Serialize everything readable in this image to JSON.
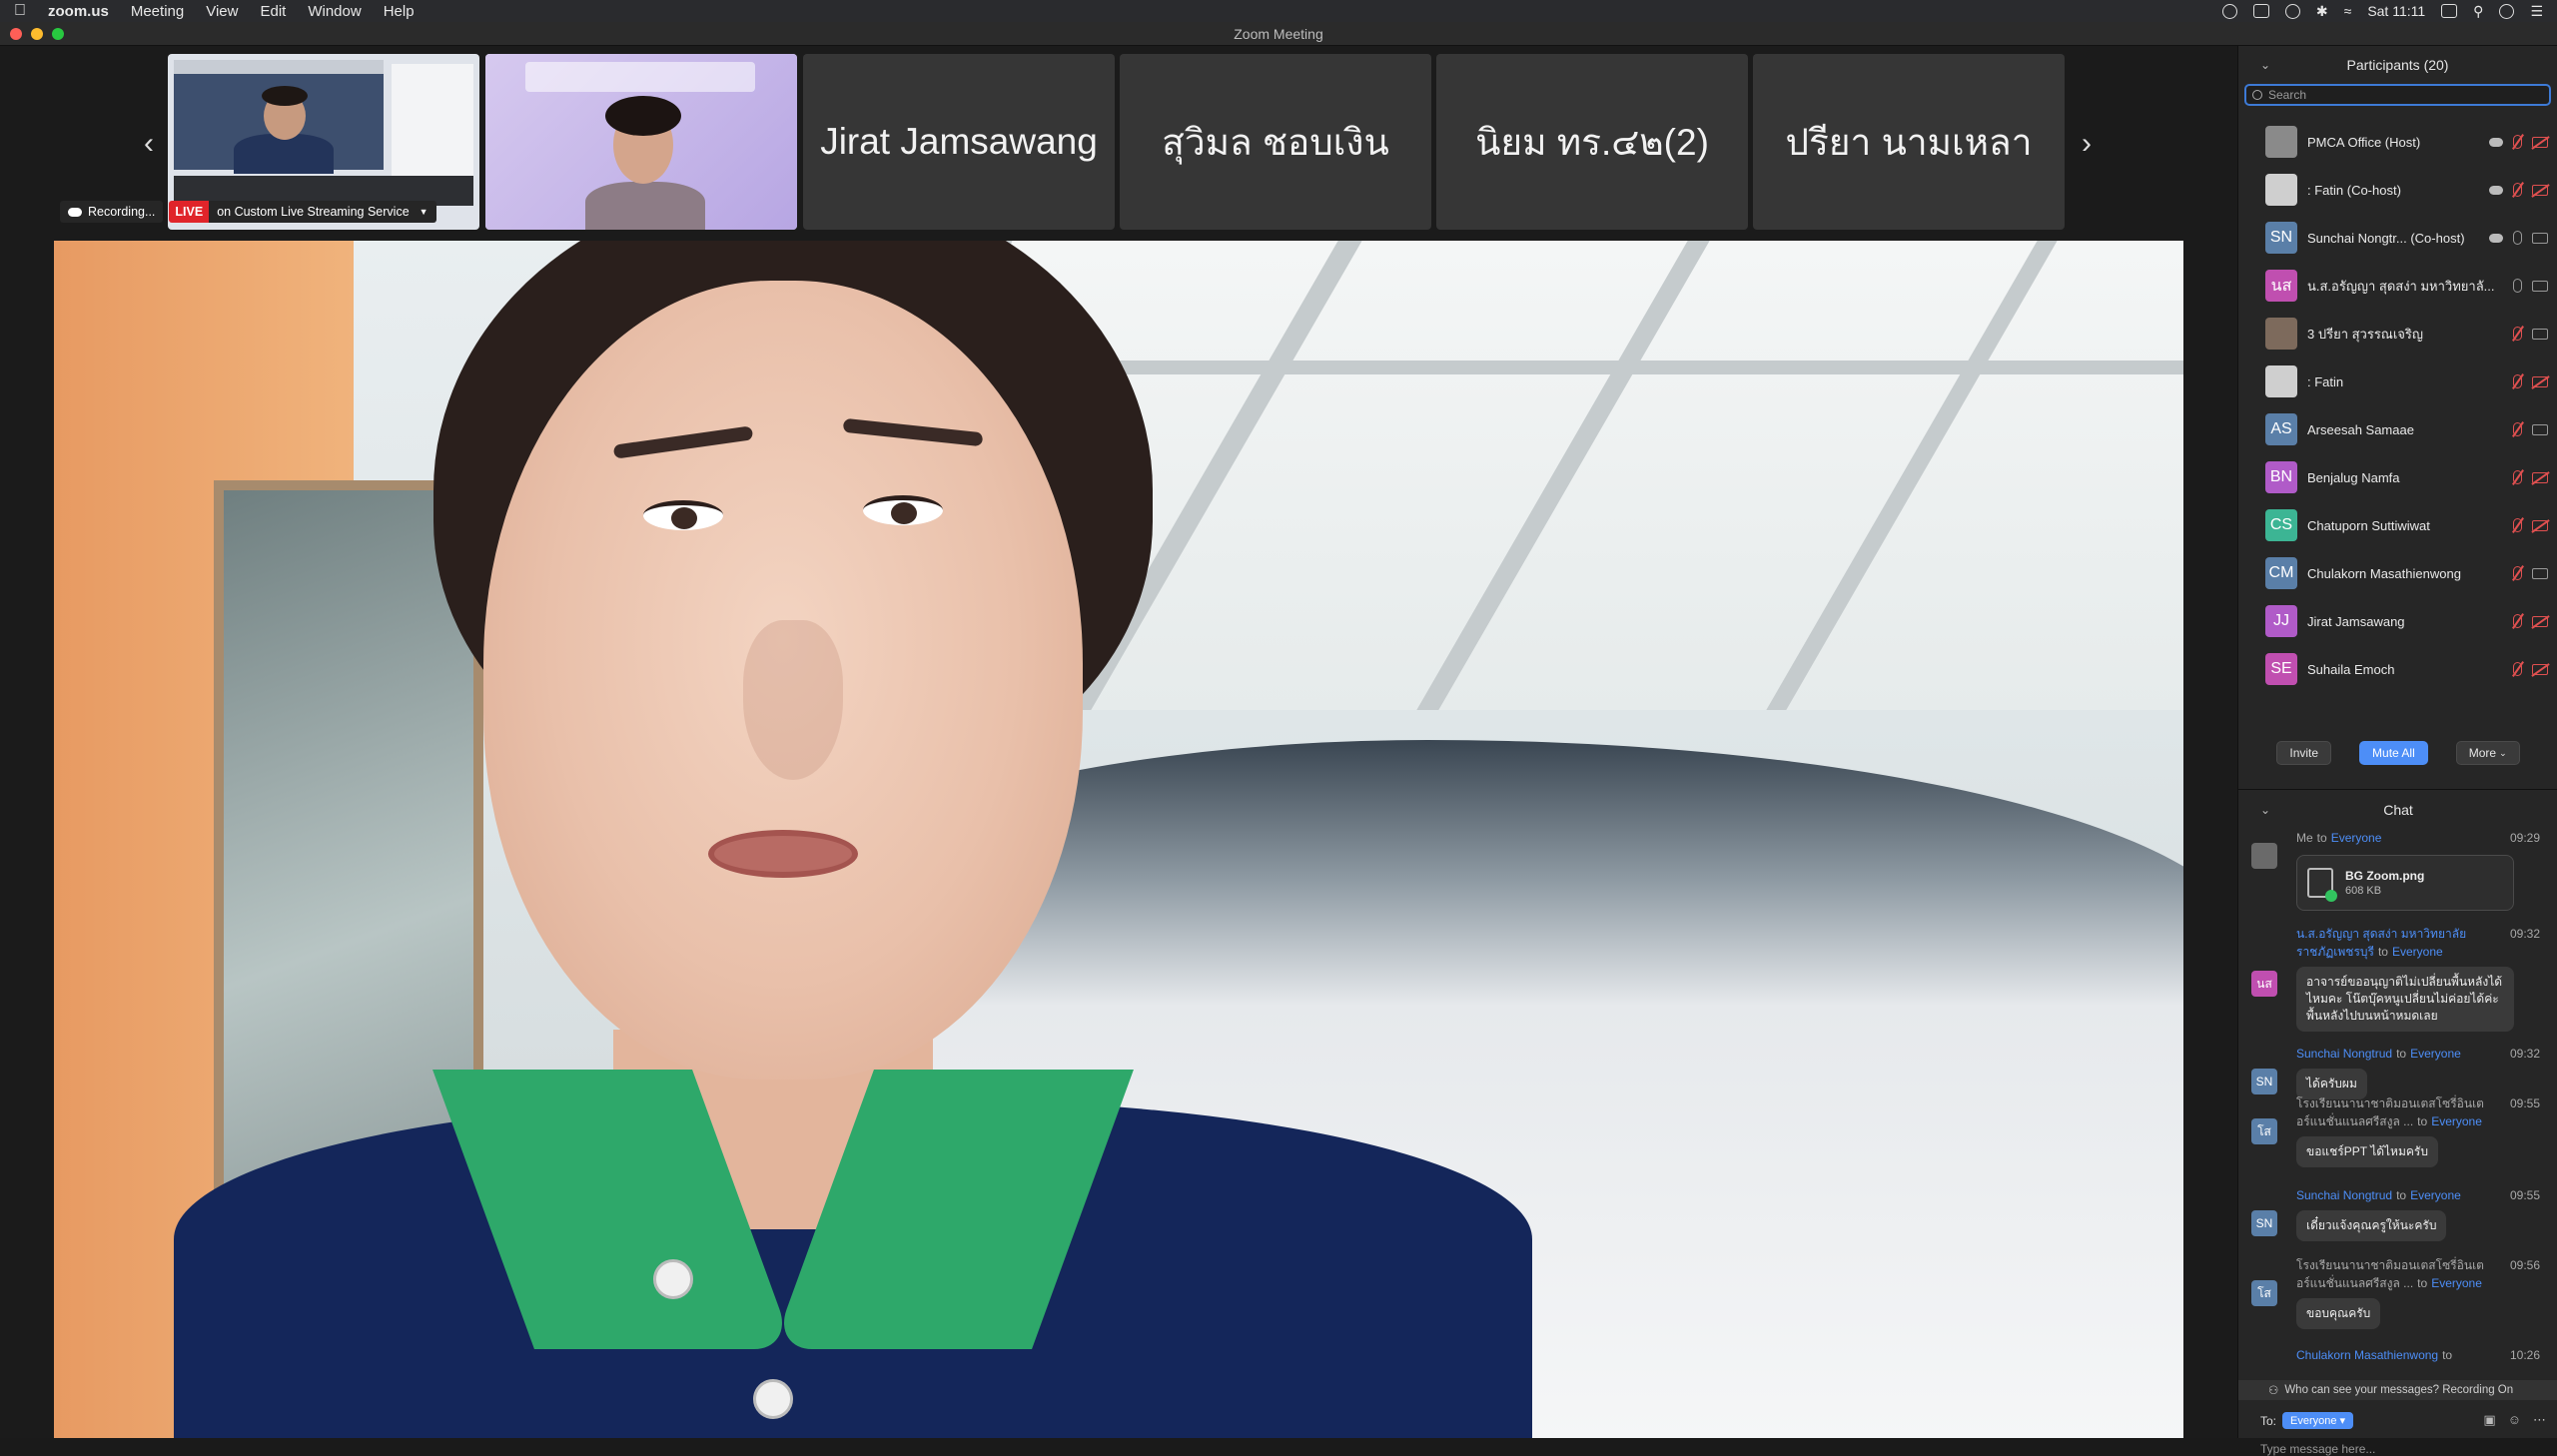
{
  "menubar": {
    "app": "zoom.us",
    "items": [
      "Meeting",
      "View",
      "Edit",
      "Window",
      "Help"
    ],
    "clock": "Sat 11:11"
  },
  "window": {
    "title": "Zoom Meeting"
  },
  "strip": {
    "tiles": [
      "Jirat Jamsawang",
      "สุวิมล  ชอบเงิน",
      "นิยม ทร.๔๒(2)",
      "ปรียา นามเหลา"
    ]
  },
  "recording": {
    "rec_label": "Recording...",
    "live_label": "LIVE",
    "stream_label": "on Custom Live Streaming Service"
  },
  "participants": {
    "title": "Participants (20)",
    "search_placeholder": "Search",
    "list": [
      {
        "name": "PMCA Office (Host)",
        "initials": "",
        "color": "#8a8a8a"
      },
      {
        "name": ": Fatin (Co-host)",
        "initials": "",
        "color": "#cfcfcf"
      },
      {
        "name": "Sunchai Nongtr... (Co-host)",
        "initials": "SN",
        "color": "#5a7fa8"
      },
      {
        "name": "น.ส.อรัญญา  สุดสง่า มหาวิทยาลั...",
        "initials": "นส",
        "color": "#c04fb0"
      },
      {
        "name": "3 ปรียา สุวรรณเจริญ",
        "initials": "",
        "color": "#7d6a5c"
      },
      {
        "name": ": Fatin",
        "initials": "",
        "color": "#cfcfcf"
      },
      {
        "name": "Arseesah Samaae",
        "initials": "AS",
        "color": "#5a7fa8"
      },
      {
        "name": "Benjalug Namfa",
        "initials": "BN",
        "color": "#b05bc8"
      },
      {
        "name": "Chatuporn Suttiwiwat",
        "initials": "CS",
        "color": "#3cb594"
      },
      {
        "name": "Chulakorn Masathienwong",
        "initials": "CM",
        "color": "#5a7fa8"
      },
      {
        "name": "Jirat Jamsawang",
        "initials": "JJ",
        "color": "#b05bc8"
      },
      {
        "name": "Suhaila Emoch",
        "initials": "SE",
        "color": "#c04fb0"
      }
    ],
    "invite_label": "Invite",
    "mute_all_label": "Mute All",
    "more_label": "More"
  },
  "chat": {
    "title": "Chat",
    "to_word": "to",
    "messages": [
      {
        "sender": "Me",
        "recipient": "Everyone",
        "time": "09:29",
        "initials": "",
        "color": "#6a6a6a",
        "file": {
          "name": "BG Zoom.png",
          "size": "608 KB"
        }
      },
      {
        "sender": "น.ส.อรัญญา  สุดสง่า มหาวิทยาลัยราชภัฏเพชรบุรี",
        "recipient": "Everyone",
        "time": "09:32",
        "initials": "นส",
        "color": "#c04fb0",
        "text": "อาจารย์ขออนุญาติไม่เปลี่ยนพื้นหลังได้ไหมคะ โน๊ตบุ๊คหนูเปลี่ยนไม่ค่อยได้ค่ะ พื้นหลังไปบนหน้าหมดเลย"
      },
      {
        "sender": "Sunchai Nongtrud",
        "recipient": "Everyone",
        "time": "09:32",
        "initials": "SN",
        "color": "#5a7fa8",
        "text": "ได้ครับผม"
      },
      {
        "sender": "โรงเรียนนานาชาติมอนเตสโซรี่อินเตอร์แนชั่นแนลศรีสงูล ...",
        "recipient": "Everyone",
        "time": "09:55",
        "initials": "โส",
        "color": "#5a7fa8",
        "text": "ขอแชร์PPT ได้ไหมครับ"
      },
      {
        "sender": "Sunchai Nongtrud",
        "recipient": "Everyone",
        "time": "09:55",
        "initials": "SN",
        "color": "#5a7fa8",
        "text": "เดี๋ยวแจ้งคุณครูให้นะครับ"
      },
      {
        "sender": "โรงเรียนนานาชาติมอนเตสโซรี่อินเตอร์แนชั่นแนลศรีสงูล ...",
        "recipient": "Everyone",
        "time": "09:56",
        "initials": "โส",
        "color": "#5a7fa8",
        "text": "ขอบคุณครับ"
      },
      {
        "sender": "Chulakorn Masathienwong",
        "recipient": "",
        "time": "10:26",
        "initials": "",
        "color": "#5a7fa8",
        "text": ""
      }
    ],
    "visibility_note": "Who can see your messages? Recording On",
    "to_label": "To:",
    "to_value": "Everyone",
    "input_placeholder": "Type message here..."
  }
}
